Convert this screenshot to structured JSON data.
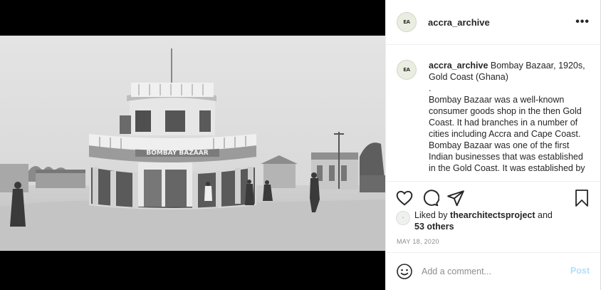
{
  "post": {
    "username": "accra_archive",
    "avatar_initials": "EA",
    "more_icon": "more-horizontal-icon",
    "caption_lines": [
      "Bombay Bazaar, 1920s, Gold Coast (Ghana)",
      ".",
      "Bombay Bazaar was a well-known consumer goods shop in the then Gold Coast. It had branches in a number of cities including Accra and Cape Coast. Bombay Bazaar was one of the first Indian businesses that was established in the Gold Coast. It was established by"
    ],
    "photo_sign": "BOMBAY BAZAAR"
  },
  "actions": {
    "icons": [
      "heart-icon",
      "comment-icon",
      "share-icon",
      "bookmark-icon"
    ]
  },
  "likes": {
    "prefix": "Liked by",
    "liker": "thearchitectsproject",
    "and": "and",
    "others": "53 others"
  },
  "date": "MAY 18, 2020",
  "comment": {
    "placeholder": "Add a comment...",
    "post_label": "Post"
  },
  "colors": {
    "post_button": "#b2dffc",
    "muted": "#8e8e8e",
    "text": "#262626"
  }
}
